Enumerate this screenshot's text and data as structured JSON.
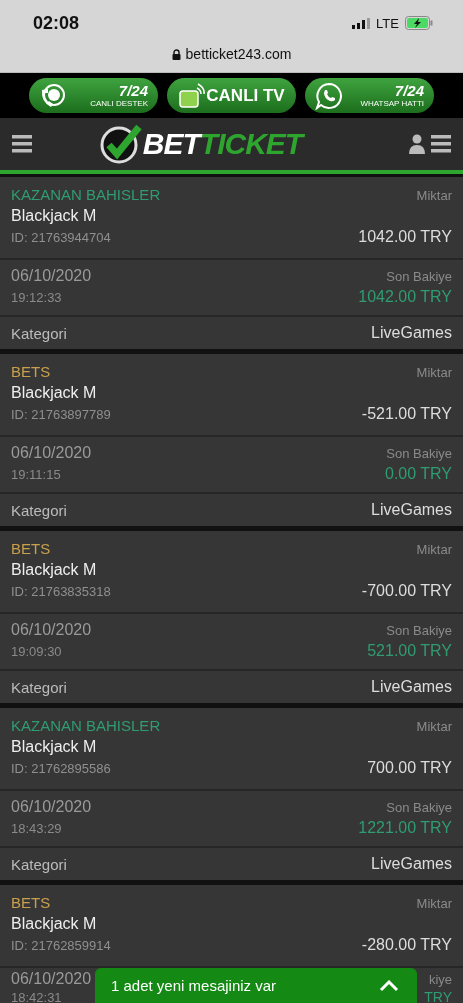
{
  "status_bar": {
    "time": "02:08",
    "network": "LTE"
  },
  "address_bar": {
    "url": "betticket243.com"
  },
  "promo_buttons": [
    {
      "kind": "support",
      "big": "7/24",
      "small": "CANLI DESTEK"
    },
    {
      "kind": "tv",
      "big": "CANLI TV"
    },
    {
      "kind": "whatsapp",
      "big": "7/24",
      "small": "WHATSAP HATTI"
    }
  ],
  "header": {
    "logo_white": "BET",
    "logo_green": "TICKET"
  },
  "transactions": [
    {
      "kind": "win",
      "type": "KAZANAN BAHISLER",
      "amount_label": "Miktar",
      "game": "Blackjack M",
      "id": "ID: 21763944704",
      "amount": "1042.00 TRY",
      "date": "06/10/2020",
      "time": "19:12:33",
      "balance_label": "Son Bakiye",
      "balance": "1042.00 TRY",
      "category_label": "Kategori",
      "category": "LiveGames"
    },
    {
      "kind": "bet",
      "type": "BETS",
      "amount_label": "Miktar",
      "game": "Blackjack M",
      "id": "ID: 21763897789",
      "amount": "-521.00 TRY",
      "date": "06/10/2020",
      "time": "19:11:15",
      "balance_label": "Son Bakiye",
      "balance": "0.00 TRY",
      "category_label": "Kategori",
      "category": "LiveGames"
    },
    {
      "kind": "bet",
      "type": "BETS",
      "amount_label": "Miktar",
      "game": "Blackjack M",
      "id": "ID: 21763835318",
      "amount": "-700.00 TRY",
      "date": "06/10/2020",
      "time": "19:09:30",
      "balance_label": "Son Bakiye",
      "balance": "521.00 TRY",
      "category_label": "Kategori",
      "category": "LiveGames"
    },
    {
      "kind": "win",
      "type": "KAZANAN BAHISLER",
      "amount_label": "Miktar",
      "game": "Blackjack M",
      "id": "ID: 21762895586",
      "amount": "700.00 TRY",
      "date": "06/10/2020",
      "time": "18:43:29",
      "balance_label": "Son Bakiye",
      "balance": "1221.00 TRY",
      "category_label": "Kategori",
      "category": "LiveGames"
    },
    {
      "kind": "bet",
      "type": "BETS",
      "amount_label": "Miktar",
      "game": "Blackjack M",
      "id": "ID: 21762859914",
      "amount": "-280.00 TRY",
      "date": "06/10/2020",
      "time": "18:42:31",
      "balance_label": "kiye",
      "balance": "TRY"
    }
  ],
  "message_toast": {
    "text": "1 adet yeni mesajiniz var"
  }
}
